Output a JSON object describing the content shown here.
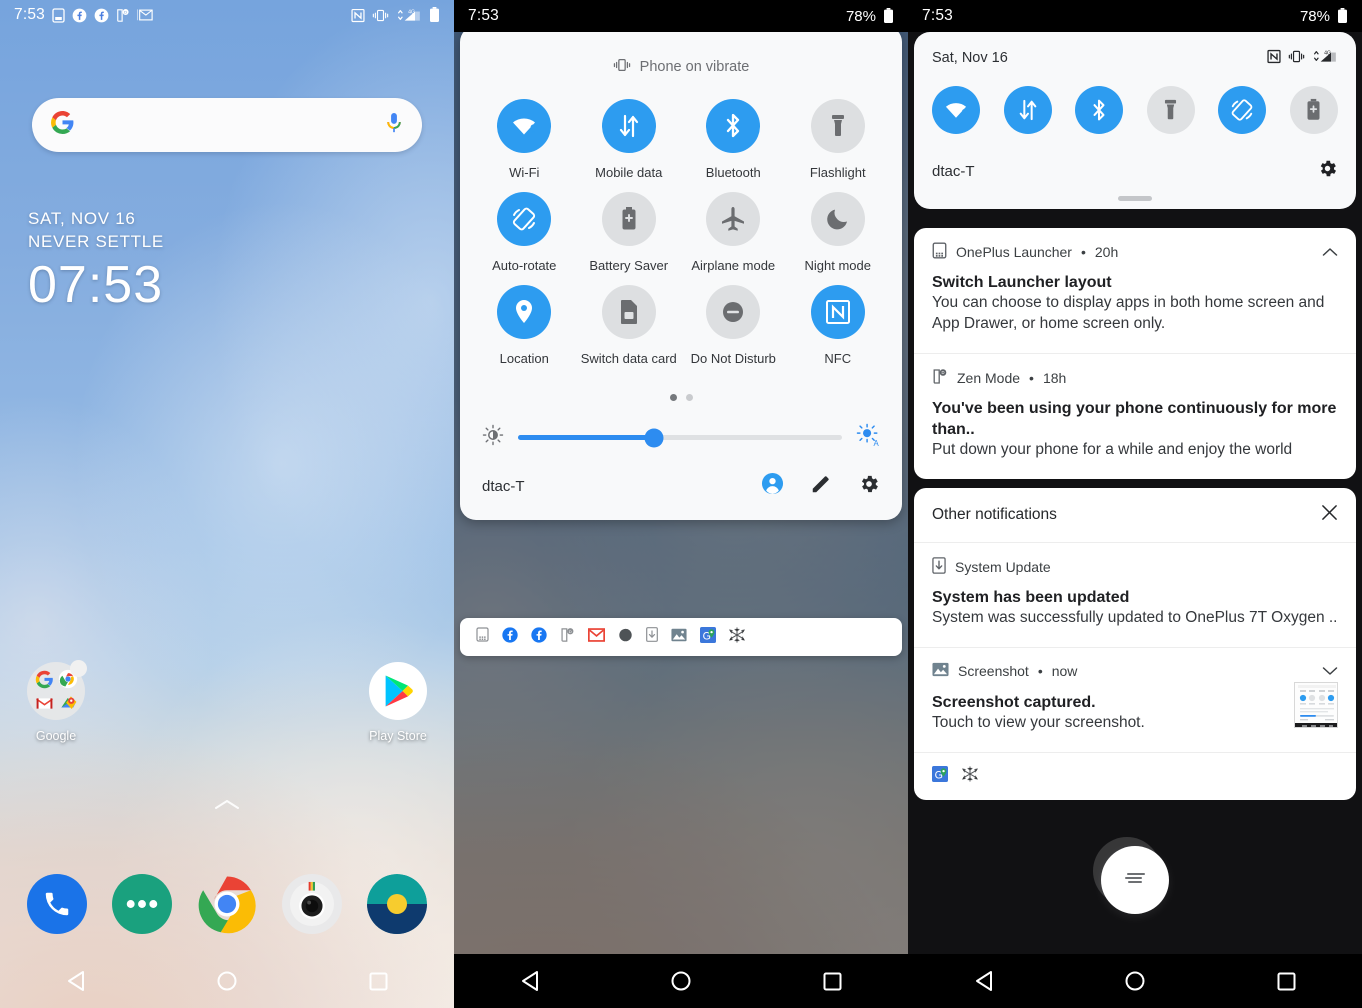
{
  "panel1": {
    "statusbar": {
      "time": "7:53",
      "left_icons": [
        "sim-card-icon",
        "facebook-icon",
        "facebook-icon",
        "zen-mode-icon",
        "gmail-icon"
      ],
      "right_icons": [
        "nfc-icon",
        "vibrate-icon",
        "mobile-data-4g-icon",
        "battery-icon"
      ]
    },
    "search": {
      "logo": "google-g-icon",
      "mic": "microphone-icon",
      "placeholder": ""
    },
    "clock_widget": {
      "date": "SAT, NOV 16",
      "subtitle": "NEVER SETTLE",
      "time": "07:53"
    },
    "home_icons": [
      {
        "label": "Google",
        "icon": "google-folder-icon"
      },
      {
        "label": "Play Store",
        "icon": "play-store-icon"
      }
    ],
    "page_up_hint": "chevron-up-icon",
    "dock": [
      {
        "name": "phone-icon"
      },
      {
        "name": "messages-icon"
      },
      {
        "name": "chrome-icon"
      },
      {
        "name": "camera-icon"
      },
      {
        "name": "gallery-icon"
      }
    ],
    "navbar": [
      "back-button",
      "home-button",
      "recents-button"
    ]
  },
  "panel2": {
    "statusbar": {
      "time": "7:53",
      "battery_pct": "78%"
    },
    "vibrate_text": "Phone on vibrate",
    "tiles": [
      {
        "label": "Wi-Fi",
        "icon": "wifi-question-icon",
        "state": "on"
      },
      {
        "label": "Mobile data",
        "icon": "mobile-data-icon",
        "state": "on"
      },
      {
        "label": "Bluetooth",
        "icon": "bluetooth-icon",
        "state": "on"
      },
      {
        "label": "Flashlight",
        "icon": "flashlight-icon",
        "state": "off"
      },
      {
        "label": "Auto-rotate",
        "icon": "auto-rotate-icon",
        "state": "on"
      },
      {
        "label": "Battery Saver",
        "icon": "battery-saver-icon",
        "state": "off"
      },
      {
        "label": "Airplane mode",
        "icon": "airplane-icon",
        "state": "off"
      },
      {
        "label": "Night mode",
        "icon": "moon-icon",
        "state": "off"
      },
      {
        "label": "Location",
        "icon": "location-pin-icon",
        "state": "on"
      },
      {
        "label": "Switch data card",
        "icon": "sim-switch-icon",
        "state": "off"
      },
      {
        "label": "Do Not Disturb",
        "icon": "do-not-disturb-icon",
        "state": "off"
      },
      {
        "label": "NFC",
        "icon": "nfc-icon",
        "state": "on"
      }
    ],
    "pager": {
      "pages": 2,
      "active": 1
    },
    "brightness": {
      "value_pct": 42,
      "low_icon": "brightness-low-icon",
      "auto_icon": "brightness-auto-icon"
    },
    "footer": {
      "carrier": "dtac-T",
      "actions": [
        "user-account-icon",
        "edit-pencil-icon",
        "settings-gear-icon"
      ]
    },
    "notification_icons": [
      "app-grid-icon",
      "facebook-icon",
      "facebook-icon",
      "zen-mode-icon",
      "gmail-icon",
      "dark-circle-icon",
      "download-icon",
      "image-icon",
      "maps-icon",
      "snowflake-icon"
    ],
    "navbar": [
      "back-button",
      "home-button",
      "recents-button"
    ]
  },
  "panel3": {
    "statusbar": {
      "time": "7:53",
      "battery_pct": "78%"
    },
    "qs_header": {
      "date": "Sat, Nov 16",
      "icons": [
        "nfc-icon",
        "vibrate-icon",
        "mobile-data-4g-icon"
      ]
    },
    "qs_tiles": [
      {
        "icon": "wifi-question-icon",
        "state": "on"
      },
      {
        "icon": "mobile-data-icon",
        "state": "on"
      },
      {
        "icon": "bluetooth-icon",
        "state": "on"
      },
      {
        "icon": "flashlight-icon",
        "state": "off"
      },
      {
        "icon": "auto-rotate-icon",
        "state": "on"
      },
      {
        "icon": "battery-saver-icon",
        "state": "off"
      }
    ],
    "qs_footer": {
      "carrier": "dtac-T",
      "settings_icon": "settings-gear-icon"
    },
    "notifications": [
      {
        "app": "OnePlus Launcher",
        "app_icon": "app-grid-icon",
        "time": "20h",
        "separator": "•",
        "title": "Switch Launcher layout",
        "body": "You can choose to display apps in both home screen and App Drawer, or home screen only.",
        "chevron": "chevron-up-icon"
      },
      {
        "app": "Zen Mode",
        "app_icon": "zen-mode-icon",
        "time": "18h",
        "separator": "•",
        "title": "You've been using your phone continuously for more than..",
        "body": "Put down your phone for a while and enjoy the world",
        "chevron": ""
      }
    ],
    "other_section": {
      "header": "Other notifications",
      "close_icon": "close-icon",
      "items": [
        {
          "app": "System Update",
          "app_icon": "system-update-icon",
          "time": "",
          "separator": "",
          "title": "System has been updated",
          "body": "System was successfully updated to OnePlus 7T Oxygen ..",
          "chevron": "",
          "thumb": ""
        },
        {
          "app": "Screenshot",
          "app_icon": "image-icon",
          "time": "now",
          "separator": "•",
          "title": "Screenshot captured.",
          "body": "Touch to view your screenshot.",
          "chevron": "chevron-down-icon",
          "thumb": "screenshot-thumbnail"
        }
      ],
      "footer_icons": [
        "maps-icon",
        "snowflake-icon"
      ]
    },
    "clear_all_button": "clear-all-icon",
    "navbar": [
      "back-button",
      "home-button",
      "recents-button"
    ]
  },
  "colors": {
    "accent_blue": "#2d9cf0",
    "tile_off": "#dfe1e3",
    "shade_bg": "#f8f9fa",
    "card_bg": "#ffffff",
    "dark_bg": "#111113",
    "text_primary": "#1f2023",
    "text_secondary": "#5f6368"
  }
}
